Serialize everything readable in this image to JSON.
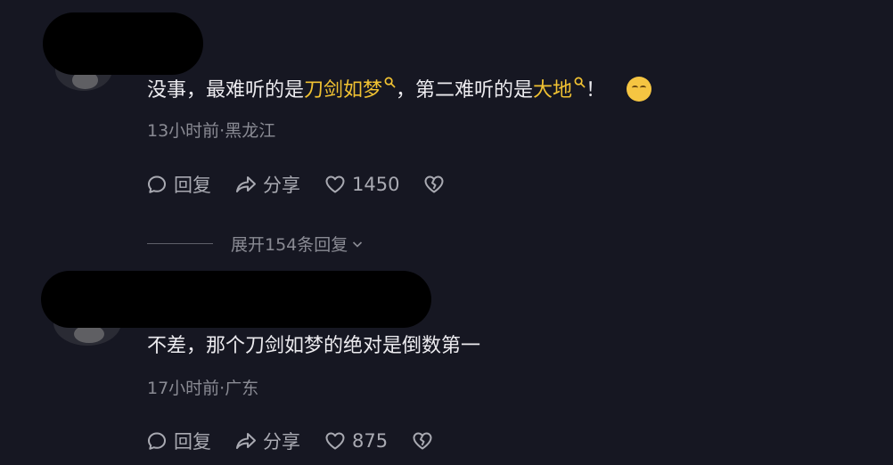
{
  "comments": [
    {
      "text_parts": [
        "没事，最难听的是",
        "刀剑如梦",
        "，第二难听的是",
        "大地",
        "！"
      ],
      "meta": "13小时前·黑龙江",
      "reply_label": "回复",
      "share_label": "分享",
      "like_count": "1450",
      "expand_label": "展开154条回复"
    },
    {
      "text": "不差，那个刀剑如梦的绝对是倒数第一",
      "meta": "17小时前·广东",
      "reply_label": "回复",
      "share_label": "分享",
      "like_count": "875"
    }
  ],
  "icons": {
    "reply": "reply-bubble-icon",
    "share": "share-arrow-icon",
    "like": "heart-icon",
    "dislike": "broken-heart-icon",
    "search": "search-icon",
    "emoji": "shushing-face-emoji-icon",
    "expand": "chevron-down-icon"
  },
  "colors": {
    "background": "#161722",
    "highlight": "#f1c232",
    "meta": "#8a8b94"
  }
}
